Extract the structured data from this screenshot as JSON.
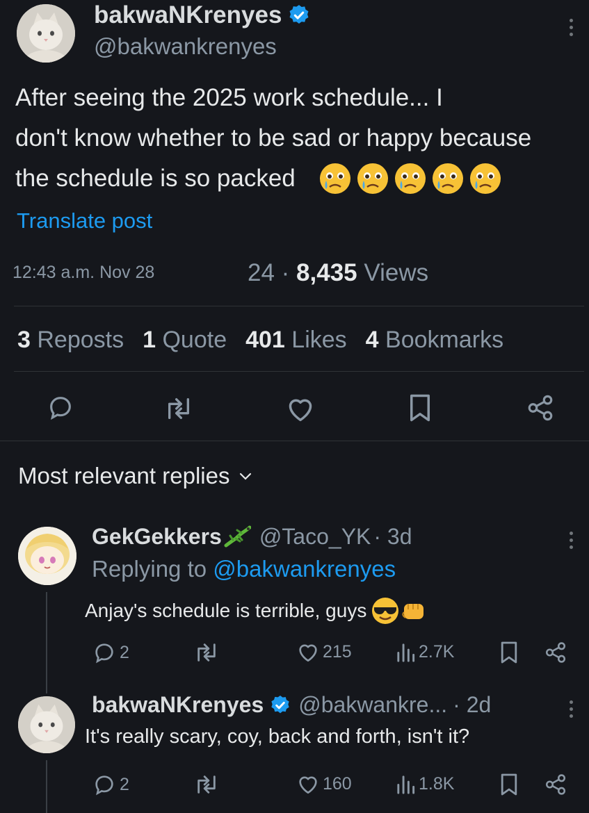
{
  "post": {
    "display_name": "bakwaNKrenyes",
    "handle": "@bakwankrenyes",
    "text_line1": "After seeing the 2025 work schedule... I",
    "text_line2": "don't know whether to be sad or happy because",
    "text_line3": "the schedule is so packed",
    "translate": "Translate post",
    "timestamp": "12:43 a.m. Nov 28",
    "views_prefix": "24 ·",
    "views_count": "8,435",
    "views_label": "Views",
    "reposts_count": "3",
    "reposts_label": "Reposts",
    "quote_count": "1",
    "quote_label": "Quote",
    "likes_count": "401",
    "likes_label": "Likes",
    "bookmarks_count": "4",
    "bookmarks_label": "Bookmarks"
  },
  "replies_header": "Most relevant replies",
  "replies": [
    {
      "display_name": "GekGekkers",
      "handle": "@Taco_YK",
      "time": "· 3d",
      "replying_prefix": "Replying to",
      "replying_handle": "@bakwankrenyes",
      "text": "Anjay's schedule is terrible, guys",
      "reply_count": "2",
      "like_count": "215",
      "view_count": "2.7K"
    },
    {
      "display_name": "bakwaNKrenyes",
      "handle": "@bakwankre...",
      "time": "· 2d",
      "text": "It's really scary, coy, back and forth, isn't it?",
      "reply_count": "2",
      "like_count": "160",
      "view_count": "1.8K"
    }
  ],
  "colors": {
    "background": "#15171c",
    "text": "#e7e9ea",
    "muted": "#8b98a5",
    "accent": "#1d9bf0"
  },
  "icons": [
    "cat-avatar",
    "verified-badge-icon",
    "more-icon",
    "reply-icon",
    "repost-icon",
    "like-icon",
    "bookmark-icon",
    "share-icon",
    "views-icon",
    "chevron-down-icon",
    "crying-emoji",
    "sunglasses-emoji",
    "fist-emoji",
    "lizard-emoji"
  ]
}
